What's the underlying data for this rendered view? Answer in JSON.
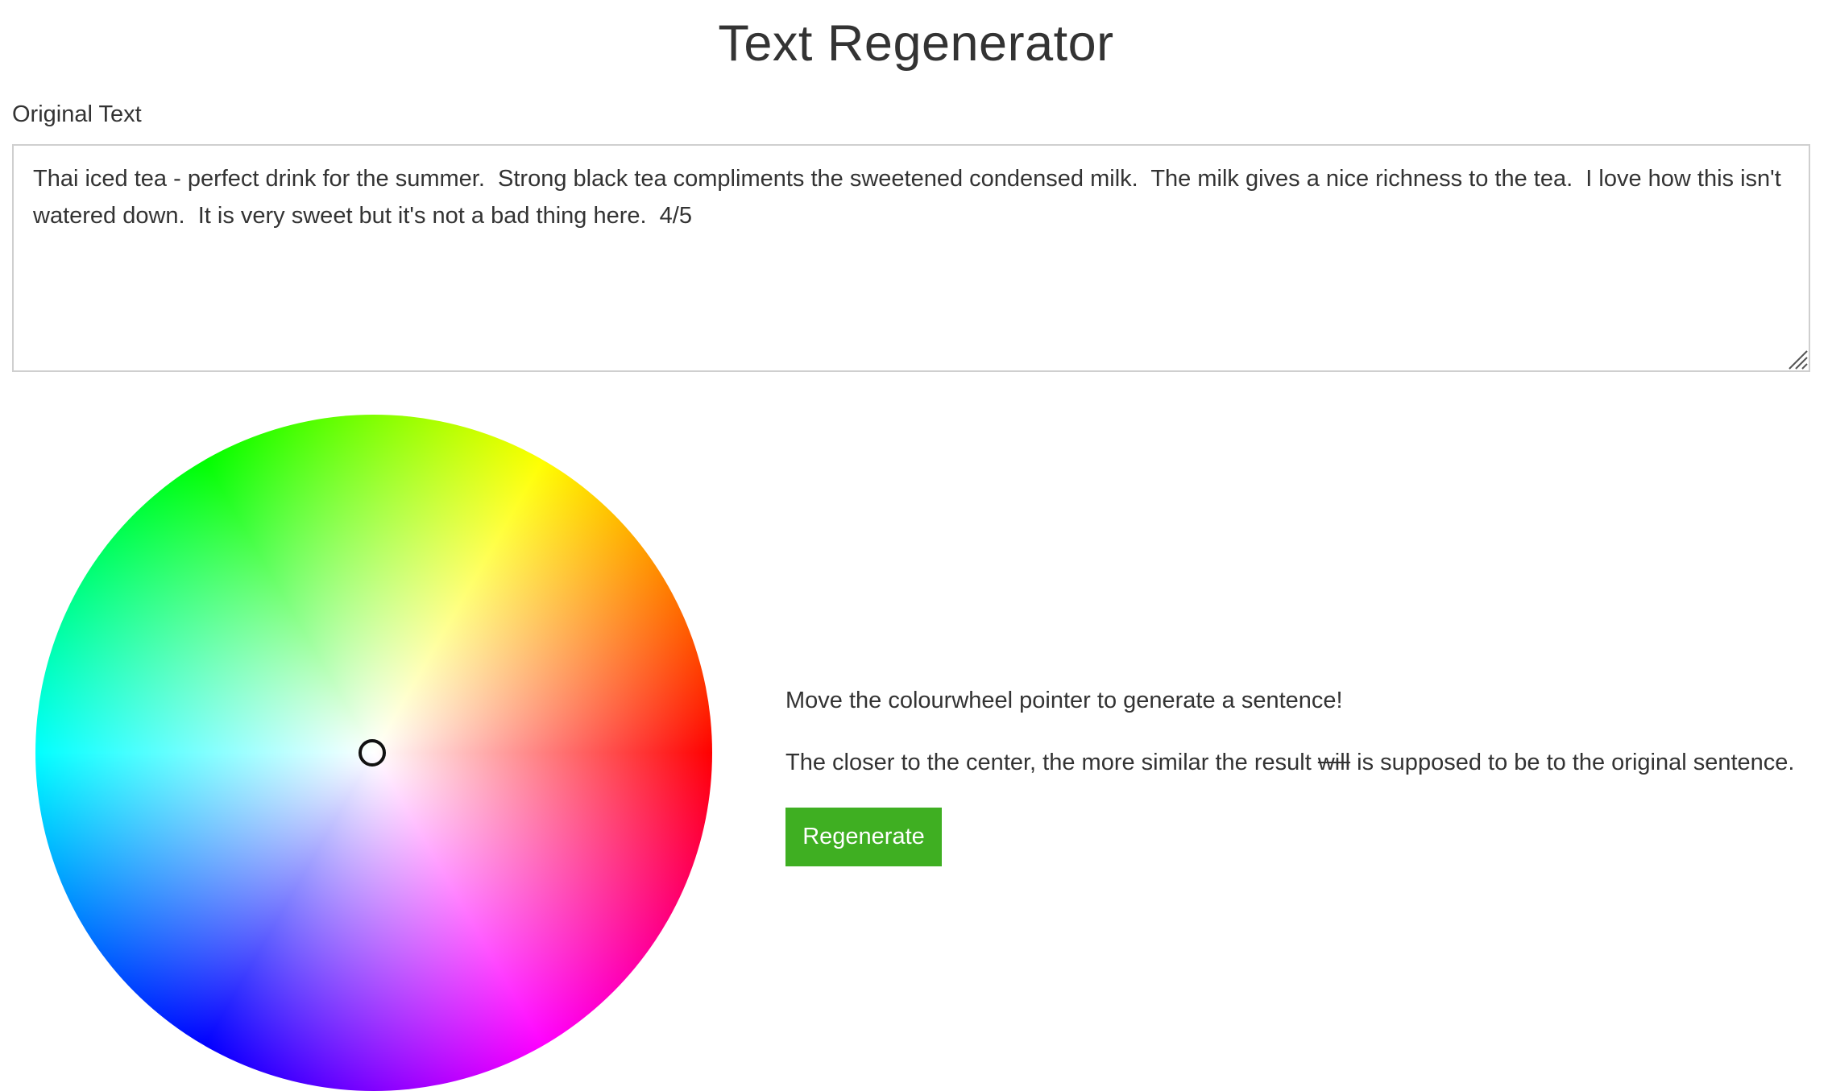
{
  "page": {
    "title": "Text Regenerator"
  },
  "original_text": {
    "label": "Original Text",
    "value": "Thai iced tea - perfect drink for the summer.  Strong black tea compliments the sweetened condensed milk.  The milk gives a nice richness to the tea.  I love how this isn't watered down.  It is very sweet but it's not a bad thing here.  4/5"
  },
  "colourwheel": {
    "pointer_position": "center",
    "hue_order_clockwise_from_right": [
      "#ff0000",
      "#ff00ff",
      "#0000ff",
      "#00ffff",
      "#00ff00",
      "#ffff00"
    ]
  },
  "instructions": {
    "line1": "Move the colourwheel pointer to generate a sentence!",
    "line2_before": "The closer to the center, the more similar the result ",
    "line2_struck": "will",
    "line2_after": " is supposed to be to the original sentence."
  },
  "actions": {
    "regenerate_label": "Regenerate",
    "regenerate_color": "#3faf22"
  }
}
